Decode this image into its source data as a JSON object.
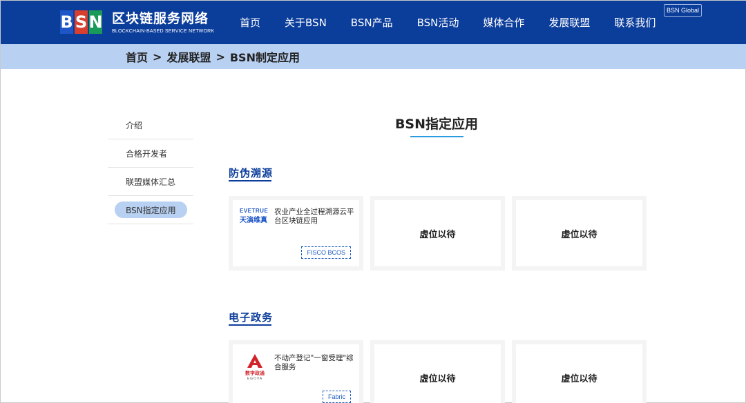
{
  "header": {
    "logo_letters": [
      "B",
      "S",
      "N"
    ],
    "logo_cn": "区块链服务网络",
    "logo_en": "BLOCKCHAIN-BASED SERVICE NETWORK",
    "nav": [
      "首页",
      "关于BSN",
      "BSN产品",
      "BSN活动",
      "媒体合作",
      "发展联盟",
      "联系我们"
    ],
    "global_label": "BSN Global"
  },
  "breadcrumb": [
    "首页",
    "发展联盟",
    "BSN制定应用"
  ],
  "breadcrumb_sep": ">",
  "sidebar": {
    "items": [
      "介绍",
      "合格开发者",
      "联盟媒体汇总",
      "BSN指定应用"
    ],
    "active_index": 3
  },
  "main": {
    "title": "BSN指定应用",
    "sections": [
      {
        "title": "防伪溯源",
        "cards": [
          {
            "logo_top": "EVETRUE",
            "logo_bottom": "天演维真",
            "name": "农业产业全过程溯源云平台区块链应用",
            "tag": "FISCO BCOS"
          },
          {
            "placeholder": "虚位以待"
          },
          {
            "placeholder": "虚位以待"
          }
        ]
      },
      {
        "title": "电子政务",
        "cards": [
          {
            "logo_top": "A",
            "logo_bottom": "数字政通",
            "logo_sub": "EGOVA",
            "name": "不动产登记\"一窗受理\"综合服务",
            "tag": "Fabric"
          },
          {
            "placeholder": "虚位以待"
          },
          {
            "placeholder": "虚位以待"
          }
        ]
      }
    ]
  },
  "colors": {
    "header_bg": "#0b3d9b",
    "breadcrumb_bg": "#b8d0f1",
    "logo_b": "#1e56c8",
    "logo_s": "#d7402e",
    "logo_n": "#1a9a58",
    "accent": "#2b9be0",
    "logo_red": "#d1232a"
  }
}
